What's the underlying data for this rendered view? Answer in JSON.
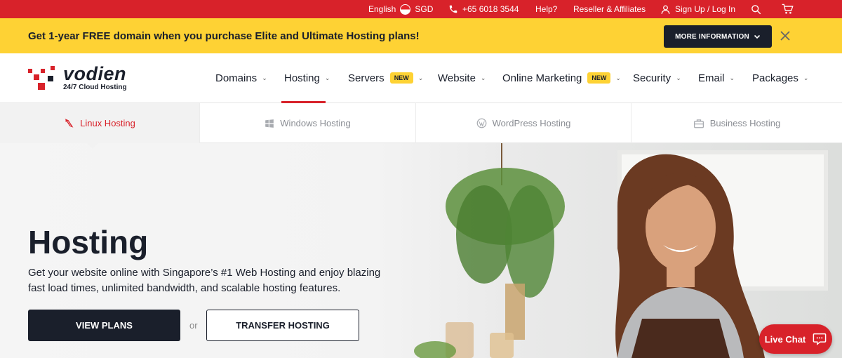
{
  "topbar": {
    "language": "English",
    "currency": "SGD",
    "phone": "+65 6018 3544",
    "help": "Help?",
    "reseller": "Reseller & Affiliates",
    "signup": "Sign Up / Log In"
  },
  "promo": {
    "text": "Get 1-year FREE domain when you purchase Elite and Ultimate Hosting plans!",
    "button": "MORE INFORMATION"
  },
  "logo": {
    "name": "vodien",
    "tagline": "24/7 Cloud Hosting"
  },
  "nav": {
    "items": [
      {
        "label": "Domains"
      },
      {
        "label": "Hosting"
      },
      {
        "label": "Servers",
        "badge": "NEW"
      },
      {
        "label": "Website"
      },
      {
        "label": "Online Marketing",
        "badge": "NEW"
      },
      {
        "label": "Security"
      },
      {
        "label": "Email"
      },
      {
        "label": "Packages"
      }
    ]
  },
  "subtabs": [
    {
      "label": "Linux Hosting"
    },
    {
      "label": "Windows Hosting"
    },
    {
      "label": "WordPress Hosting"
    },
    {
      "label": "Business Hosting"
    }
  ],
  "hero": {
    "title": "Hosting",
    "description": "Get your website online with Singapore’s #1 Web Hosting and enjoy blazing fast load times, unlimited bandwidth, and scalable hosting features.",
    "primary_button": "VIEW PLANS",
    "or": "or",
    "secondary_button": "TRANSFER HOSTING"
  },
  "livechat": {
    "label": "Live Chat"
  },
  "colors": {
    "brand_red": "#d8222a",
    "promo_yellow": "#fed234",
    "dark": "#1a1f2b"
  }
}
